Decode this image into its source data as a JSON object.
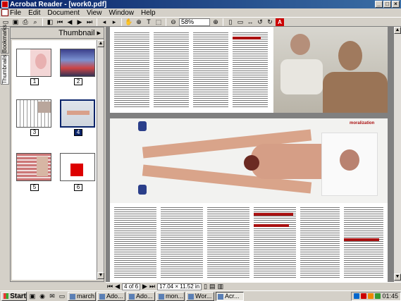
{
  "window": {
    "title": "Acrobat Reader - [work0.pdf]",
    "min": "_",
    "max": "□",
    "close": "×"
  },
  "menu": [
    "File",
    "Edit",
    "Document",
    "View",
    "Window",
    "Help"
  ],
  "toolbar": {
    "zoom_value": "58%"
  },
  "sidebar": {
    "tab_thumbnails": "Thumbnails",
    "tab_bookmarks": "Bookmarks",
    "panel_title": "Thumbnail ▸"
  },
  "thumbnails": [
    {
      "num": "1"
    },
    {
      "num": "2"
    },
    {
      "num": "3"
    },
    {
      "num": "4",
      "selected": true
    },
    {
      "num": "5"
    },
    {
      "num": "6"
    }
  ],
  "page": {
    "logo_text": "moralization"
  },
  "status": {
    "page_field": "4 of 6",
    "size_field": "17.04 × 11.52 in"
  },
  "taskbar": {
    "start": "Start",
    "tasks": [
      "march",
      "Ado...",
      "Ado...",
      "mon...",
      "Wor...",
      "Acr..."
    ],
    "clock": "01:45"
  },
  "colors": {
    "title_start": "#0a246a",
    "title_end": "#3a6ea5",
    "accent_red": "#a11111",
    "doc_bg": "#808080"
  }
}
